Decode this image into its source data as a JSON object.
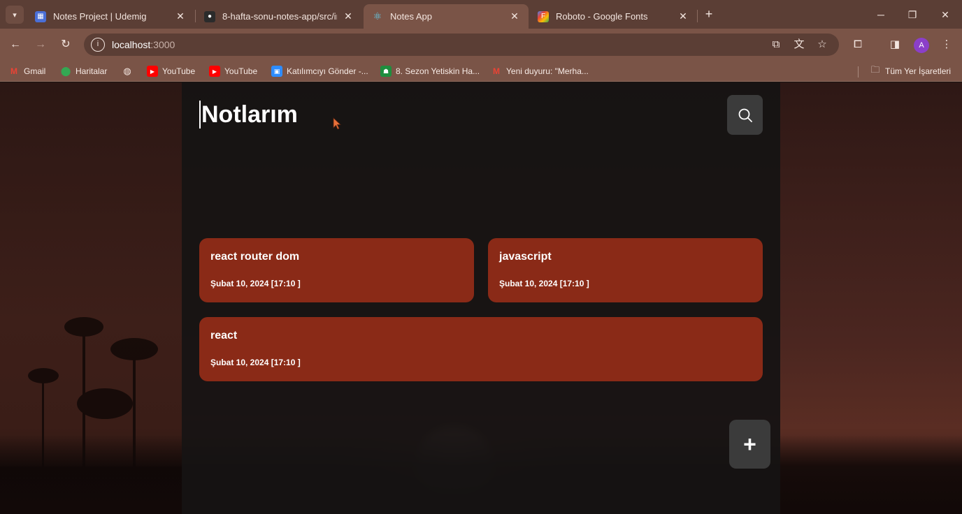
{
  "browser": {
    "tabs": [
      {
        "title": "Notes Project | Udemig",
        "active": false
      },
      {
        "title": "8-hafta-sonu-notes-app/src/ind",
        "active": false
      },
      {
        "title": "Notes App",
        "active": true
      },
      {
        "title": "Roboto - Google Fonts",
        "active": false
      }
    ],
    "url_host": "localhost",
    "url_port": ":3000",
    "profile_initial": "A",
    "bookmarks": [
      {
        "label": "Gmail",
        "icon": "gmail-icon"
      },
      {
        "label": "Haritalar",
        "icon": "maps-icon"
      },
      {
        "label": "",
        "icon": "globe-icon"
      },
      {
        "label": "YouTube",
        "icon": "youtube-icon"
      },
      {
        "label": "YouTube",
        "icon": "youtube-icon"
      },
      {
        "label": "Katılımcıyı Gönder -...",
        "icon": "zoom-icon"
      },
      {
        "label": "8. Sezon Yetiskin Ha...",
        "icon": "classroom-icon"
      },
      {
        "label": "Yeni duyuru: \"Merha...",
        "icon": "gmail-icon"
      }
    ],
    "all_bookmarks_label": "Tüm Yer İşaretleri"
  },
  "app": {
    "title": "Notlarım",
    "notes": [
      {
        "title": "react router dom",
        "date": "Şubat 10, 2024 [17:10 ]"
      },
      {
        "title": "javascript",
        "date": "Şubat 10, 2024 [17:10 ]"
      },
      {
        "title": "react",
        "date": "Şubat 10, 2024 [17:10 ]"
      }
    ],
    "add_label": "+"
  },
  "colors": {
    "note_bg": "#8a2a17",
    "app_bg": "#161414",
    "button_bg": "#3b3b3b",
    "chrome_tab_active": "#7a5447",
    "chrome_tabstrip": "#5b3e35"
  }
}
